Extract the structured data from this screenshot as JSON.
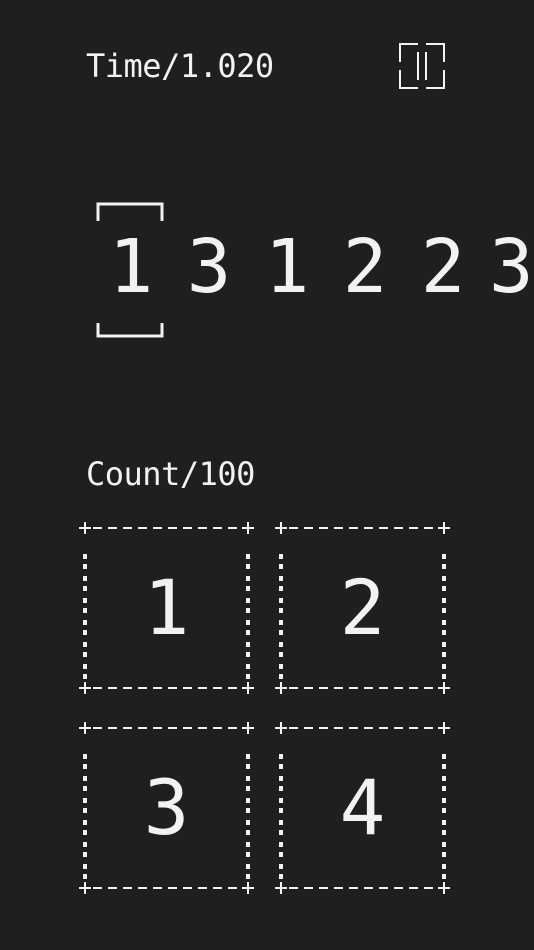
{
  "hud": {
    "time": "Time/1.020",
    "count": "Count/100",
    "pause_icon": "pause-icon"
  },
  "sequence": {
    "digits": [
      "1",
      "3",
      "1",
      "2",
      "2",
      "3"
    ],
    "current_index": 0
  },
  "pads": [
    {
      "label": "1"
    },
    {
      "label": "2"
    },
    {
      "label": "3"
    },
    {
      "label": "4"
    }
  ],
  "colors": {
    "background": "#1f1f1f",
    "foreground": "#f2f2f2"
  }
}
